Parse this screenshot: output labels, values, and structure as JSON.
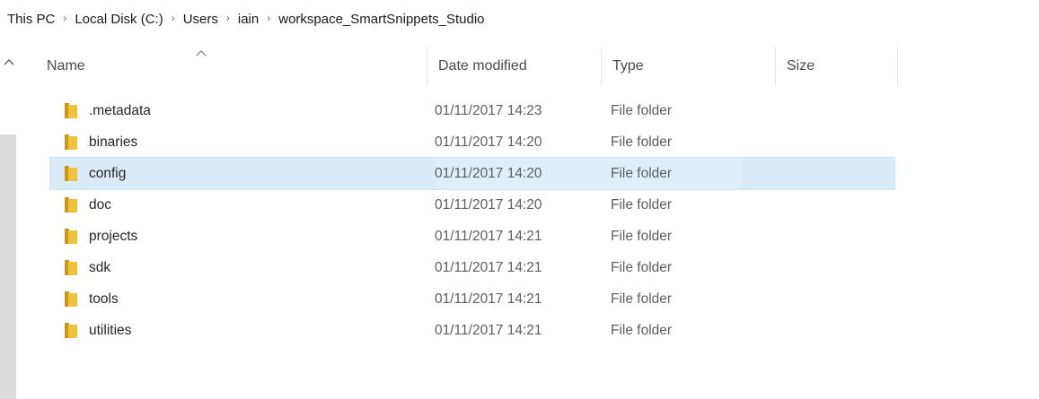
{
  "breadcrumb": {
    "items": [
      "This PC",
      "Local Disk (C:)",
      "Users",
      "iain",
      "workspace_SmartSnippets_Studio"
    ],
    "separator": "›"
  },
  "columns": {
    "name": "Name",
    "date_modified": "Date modified",
    "type": "Type",
    "size": "Size"
  },
  "files": [
    {
      "name": ".metadata",
      "date": "01/11/2017 14:23",
      "type": "File folder",
      "selected": false
    },
    {
      "name": "binaries",
      "date": "01/11/2017 14:20",
      "type": "File folder",
      "selected": false
    },
    {
      "name": "config",
      "date": "01/11/2017 14:20",
      "type": "File folder",
      "selected": true
    },
    {
      "name": "doc",
      "date": "01/11/2017 14:20",
      "type": "File folder",
      "selected": false
    },
    {
      "name": "projects",
      "date": "01/11/2017 14:21",
      "type": "File folder",
      "selected": false
    },
    {
      "name": "sdk",
      "date": "01/11/2017 14:21",
      "type": "File folder",
      "selected": false
    },
    {
      "name": "tools",
      "date": "01/11/2017 14:21",
      "type": "File folder",
      "selected": false
    },
    {
      "name": "utilities",
      "date": "01/11/2017 14:21",
      "type": "File folder",
      "selected": false
    }
  ],
  "icons": {
    "folder": "folder-icon",
    "sort": "sort-ascending-icon",
    "scroll_up": "scroll-up-icon"
  },
  "colors": {
    "selection": "#d9ebf9",
    "folder": "#e8b923",
    "scrollbar": "#dcdcdc"
  }
}
